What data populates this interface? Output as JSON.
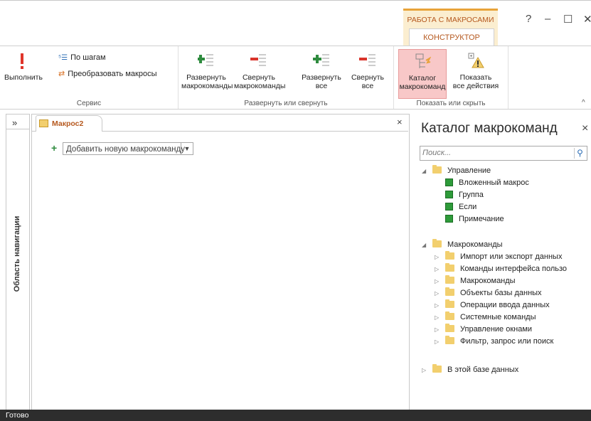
{
  "ribbon_tabs": {
    "context_group": "РАБОТА С МАКРОСАМИ",
    "active_tab": "КОНСТРУКТОР"
  },
  "window_controls": {
    "help": "?",
    "minimize": "–",
    "maximize": "☐",
    "close": "✕"
  },
  "ribbon": {
    "run": {
      "icon": "exclamation-icon",
      "label": "Выполнить"
    },
    "step": {
      "icon": "step-icon",
      "label": "По шагам"
    },
    "convert": {
      "icon": "convert-icon",
      "label": "Преобразовать макросы"
    },
    "service_group": "Сервис",
    "expand_actions": {
      "line1": "Развернуть",
      "line2": "макрокоманды"
    },
    "collapse_actions": {
      "line1": "Свернуть",
      "line2": "макрокоманды"
    },
    "expand_all": {
      "line1": "Развернуть",
      "line2": "все"
    },
    "collapse_all": {
      "line1": "Свернуть",
      "line2": "все"
    },
    "expand_group": "Развернуть или свернуть",
    "action_catalog": {
      "line1": "Каталог",
      "line2": "макрокоманд"
    },
    "show_all": {
      "line1": "Показать",
      "line2": "все действия"
    },
    "show_group": "Показать или скрыть"
  },
  "nav_pane": {
    "label": "Область навигации",
    "toggle": "»"
  },
  "document": {
    "tab_label": "Макрос2",
    "close": "×",
    "add_action_placeholder": "Добавить новую макрокоманду"
  },
  "catalog": {
    "title": "Каталог макрокоманд",
    "close": "×",
    "search_placeholder": "Поиск...",
    "control_group": "Управление",
    "control_items": [
      "Вложенный макрос",
      "Группа",
      "Если",
      "Примечание"
    ],
    "actions_group": "Макрокоманды",
    "actions_items": [
      "Импорт или экспорт данных",
      "Команды интерфейса пользо",
      "Макрокоманды",
      "Объекты базы данных",
      "Операции ввода данных",
      "Системные команды",
      "Управление окнами",
      "Фильтр, запрос или поиск"
    ],
    "db_group": "В этой базе данных"
  },
  "status": {
    "text": "Готово"
  },
  "colors": {
    "accent": "#b6591f",
    "context_bg": "#fbeed0",
    "selected_btn": "#f8c8c8",
    "status_bg": "#2d2d2d"
  }
}
